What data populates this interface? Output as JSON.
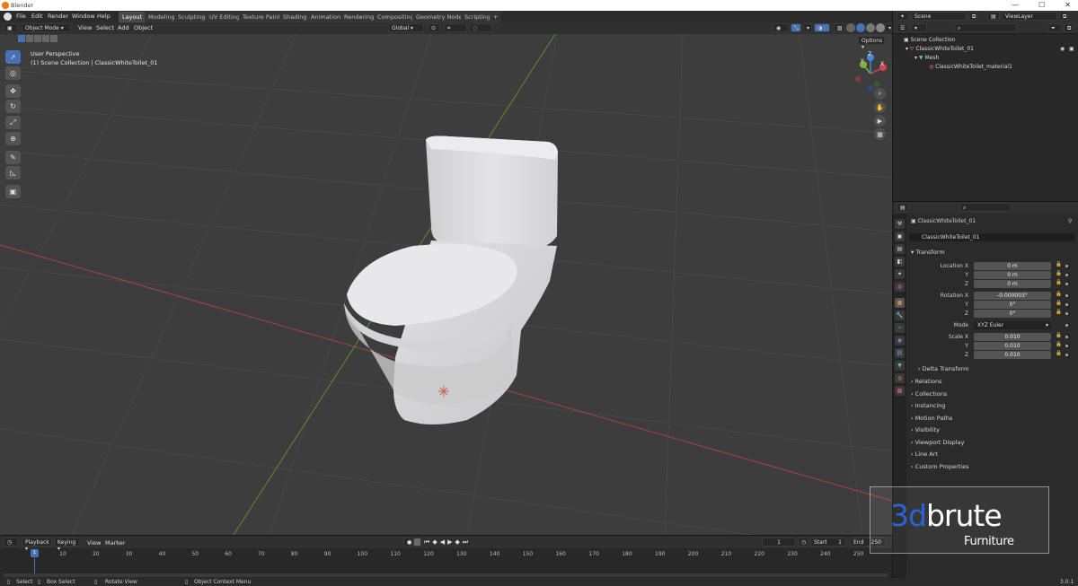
{
  "window": {
    "title": "Blender",
    "controls": [
      "—",
      "☐",
      "✕"
    ]
  },
  "menu": [
    "File",
    "Edit",
    "Render",
    "Window",
    "Help"
  ],
  "workspaces": [
    "Layout",
    "Modeling",
    "Sculpting",
    "UV Editing",
    "Texture Paint",
    "Shading",
    "Animation",
    "Rendering",
    "Compositing",
    "Geometry Nodes",
    "Scripting",
    "+"
  ],
  "viewport_header": {
    "mode": "Object Mode",
    "menus": [
      "View",
      "Select",
      "Add",
      "Object"
    ],
    "orientation": "Global",
    "options": "Options"
  },
  "viewport": {
    "perspective": "User Perspective",
    "collection": "(1) Scene Collection | ClassicWhiteToilet_01",
    "gizmo": {
      "x": "X",
      "y": "Y",
      "z": "Z"
    }
  },
  "toolbar_icons": [
    "cursor-select-icon",
    "cursor-icon",
    "move-icon",
    "rotate-icon",
    "scale-icon",
    "transform-icon",
    "annotate-icon",
    "measure-icon",
    "add-cube-icon"
  ],
  "scene": {
    "name": "Scene",
    "view_layer": "ViewLayer"
  },
  "outliner": {
    "root": "Scene Collection",
    "object": "ClassicWhiteToilet_01",
    "mesh": "Mesh",
    "material": "ClassicWhiteToilet_material1"
  },
  "properties": {
    "object_name": "ClassicWhiteToilet_01",
    "name_field": "ClassicWhiteToilet_01",
    "transform_label": "Transform",
    "location": {
      "label": "Location X",
      "x": "0 m",
      "y": "0 m",
      "z": "0 m"
    },
    "rotation": {
      "label": "Rotation X",
      "x": "-0.000003°",
      "y": "0°",
      "z": "0°"
    },
    "mode": {
      "label": "Mode",
      "value": "XYZ Euler"
    },
    "scale": {
      "label": "Scale X",
      "x": "0.010",
      "y": "0.010",
      "z": "0.010"
    },
    "axis_labels": {
      "y": "Y",
      "z": "Z"
    },
    "delta": "Delta Transform",
    "sections": [
      "Relations",
      "Collections",
      "Instancing",
      "Motion Paths",
      "Visibility",
      "Viewport Display",
      "Line Art",
      "Custom Properties"
    ]
  },
  "timeline": {
    "menus": [
      "Playback",
      "Keying",
      "View",
      "Marker"
    ],
    "current_frame": "1",
    "start_label": "Start",
    "start": "1",
    "end_label": "End",
    "end": "250",
    "ticks": [
      "1",
      "10",
      "20",
      "30",
      "40",
      "50",
      "60",
      "70",
      "80",
      "90",
      "100",
      "110",
      "120",
      "130",
      "140",
      "150",
      "160",
      "170",
      "180",
      "190",
      "200",
      "210",
      "220",
      "230",
      "240",
      "250"
    ],
    "playhead": "1"
  },
  "statusbar": {
    "select": "Select",
    "box_select": "Box Select",
    "rotate": "Rotate View",
    "context": "Object Context Menu",
    "version": "3.0.1"
  },
  "watermark": {
    "brand_a": "3d",
    "brand_b": "brute",
    "sub": "Furniture"
  },
  "colors": {
    "accent": "#4772b3",
    "viewport_bg": "#3d3d3d",
    "x_axis": "#a8433f",
    "y_axis": "#5e8b2e",
    "gizmo_x": "#d6434d",
    "gizmo_y": "#7cb33a",
    "gizmo_z": "#4a86d6",
    "watermark_blue": "#2a63d9"
  }
}
